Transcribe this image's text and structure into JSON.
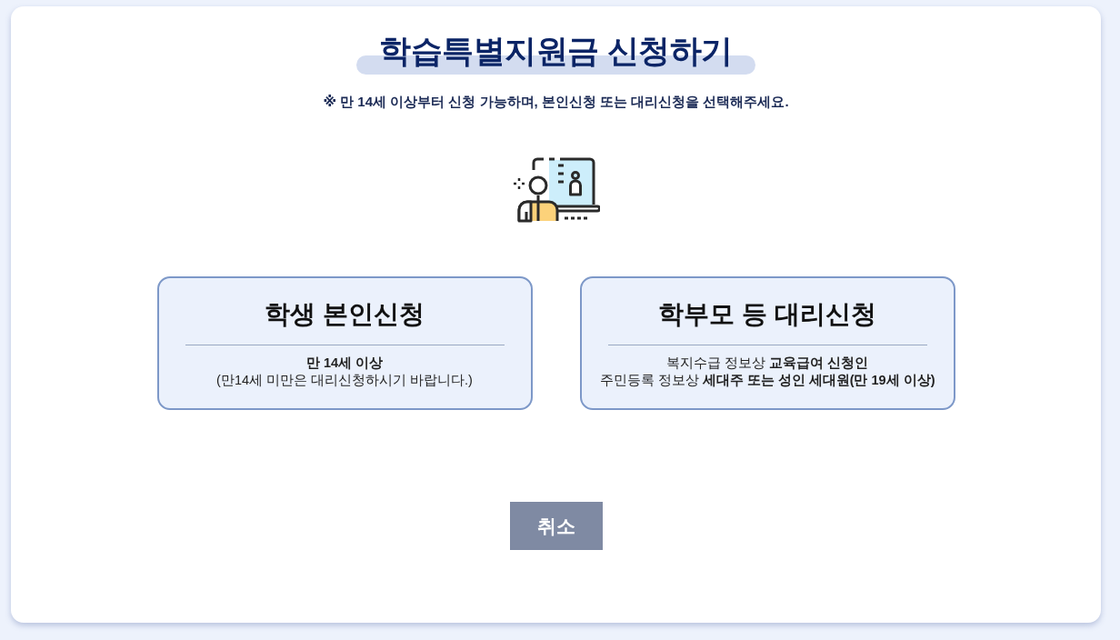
{
  "title": "학습특별지원금 신청하기",
  "notice": "※ 만 14세 이상부터 신청 가능하며, 본인신청 또는 대리신청을 선택해주세요.",
  "options": [
    {
      "title": "학생 본인신청",
      "lines": [
        {
          "text": "만 14세 이상",
          "bold": true
        },
        {
          "text": "(만14세 미만은 대리신청하시기 바랍니다.)",
          "bold": false
        }
      ]
    },
    {
      "title": "학부모 등 대리신청",
      "lines": [
        {
          "text": "복지수급 정보상 **교육급여 신청인**",
          "bold": false
        },
        {
          "text": "주민등록 정보상 **세대주 또는 성인 세대원(만 19세 이상)**",
          "bold": false
        }
      ]
    }
  ],
  "cancel_button": "취소"
}
